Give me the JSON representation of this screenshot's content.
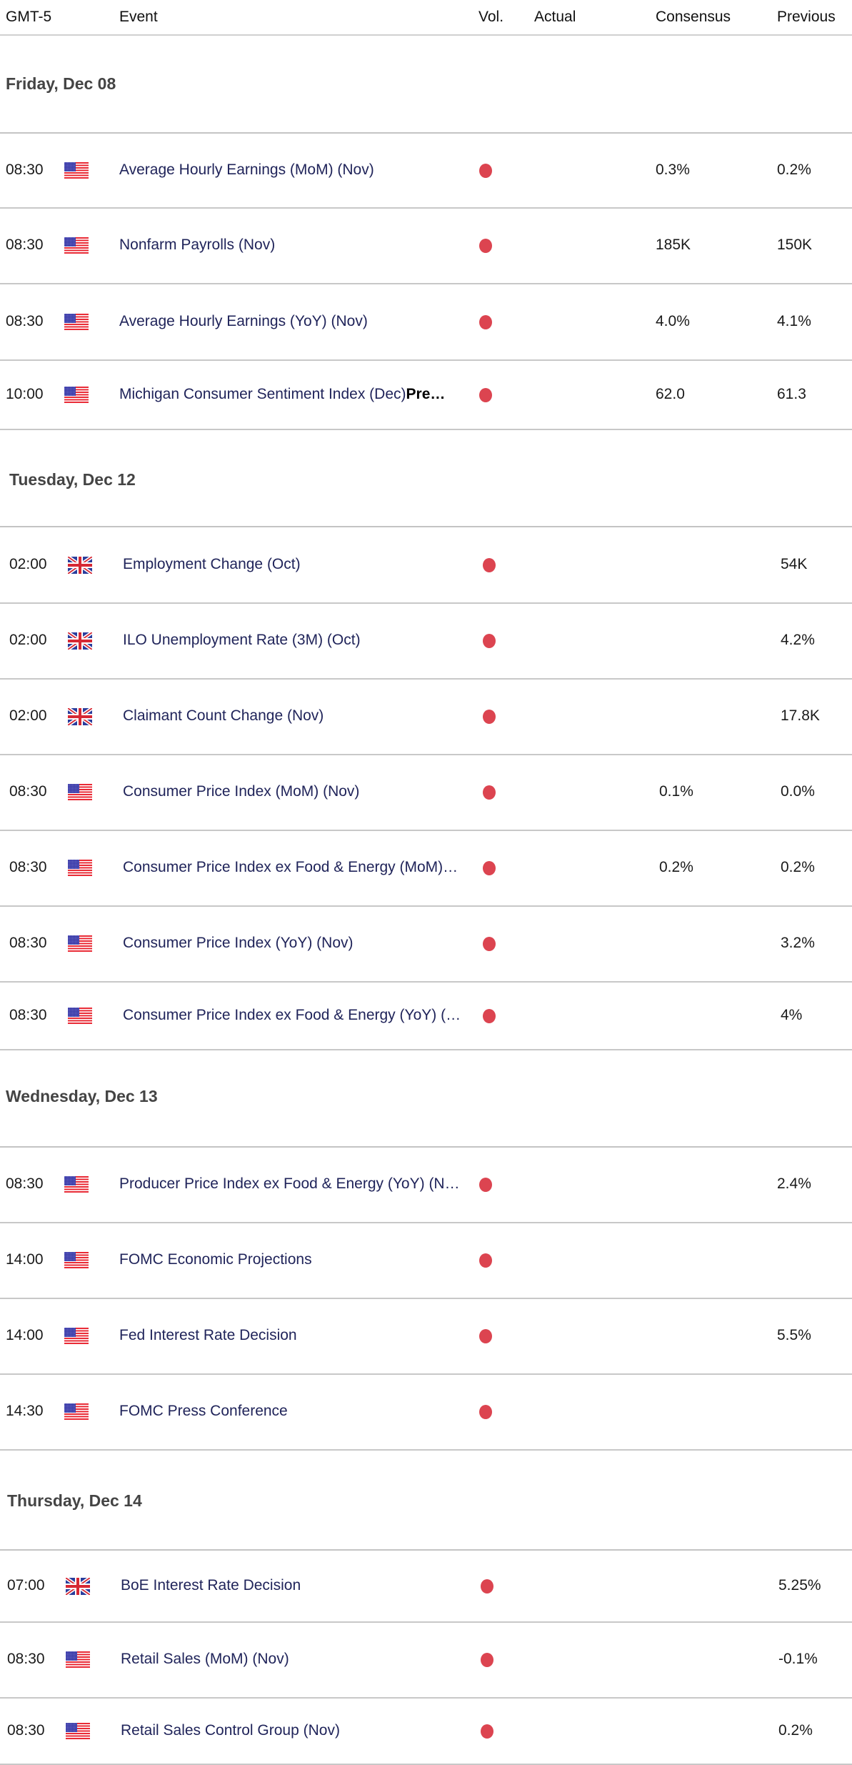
{
  "header": {
    "timezone": "GMT-5",
    "event": "Event",
    "volatility": "Vol.",
    "actual": "Actual",
    "consensus": "Consensus",
    "previous": "Previous"
  },
  "colors": {
    "volatility_high": "#dc4450",
    "event_text": "#20245a",
    "group_title": "#444444"
  },
  "groups": [
    {
      "title": "Friday, Dec 08",
      "events": [
        {
          "time": "08:30",
          "country": "US",
          "flag_icon": "us-flag-icon",
          "event": "Average Hourly Earnings (MoM) (Nov)",
          "volatility": "high",
          "actual": "",
          "consensus": "0.3%",
          "previous": "0.2%"
        },
        {
          "time": "08:30",
          "country": "US",
          "flag_icon": "us-flag-icon",
          "event": "Nonfarm Payrolls (Nov)",
          "volatility": "high",
          "actual": "",
          "consensus": "185K",
          "previous": "150K"
        },
        {
          "time": "08:30",
          "country": "US",
          "flag_icon": "us-flag-icon",
          "event": "Average Hourly Earnings (YoY) (Nov)",
          "volatility": "high",
          "actual": "",
          "consensus": "4.0%",
          "previous": "4.1%"
        },
        {
          "time": "10:00",
          "country": "US",
          "flag_icon": "us-flag-icon",
          "event": "Michigan Consumer Sentiment Index (Dec)",
          "event_suffix": "Pre…",
          "volatility": "high",
          "actual": "",
          "consensus": "62.0",
          "previous": "61.3"
        }
      ]
    },
    {
      "title": "Tuesday, Dec 12",
      "events": [
        {
          "time": "02:00",
          "country": "UK",
          "flag_icon": "uk-flag-icon",
          "event": "Employment Change (Oct)",
          "volatility": "high",
          "actual": "",
          "consensus": "",
          "previous": "54K"
        },
        {
          "time": "02:00",
          "country": "UK",
          "flag_icon": "uk-flag-icon",
          "event": "ILO Unemployment Rate (3M) (Oct)",
          "volatility": "high",
          "actual": "",
          "consensus": "",
          "previous": "4.2%"
        },
        {
          "time": "02:00",
          "country": "UK",
          "flag_icon": "uk-flag-icon",
          "event": "Claimant Count Change (Nov)",
          "volatility": "high",
          "actual": "",
          "consensus": "",
          "previous": "17.8K"
        },
        {
          "time": "08:30",
          "country": "US",
          "flag_icon": "us-flag-icon",
          "event": "Consumer Price Index (MoM) (Nov)",
          "volatility": "high",
          "actual": "",
          "consensus": "0.1%",
          "previous": "0.0%"
        },
        {
          "time": "08:30",
          "country": "US",
          "flag_icon": "us-flag-icon",
          "event": "Consumer Price Index ex Food & Energy (MoM)…",
          "volatility": "high",
          "actual": "",
          "consensus": "0.2%",
          "previous": "0.2%"
        },
        {
          "time": "08:30",
          "country": "US",
          "flag_icon": "us-flag-icon",
          "event": "Consumer Price Index (YoY) (Nov)",
          "volatility": "high",
          "actual": "",
          "consensus": "",
          "previous": "3.2%"
        },
        {
          "time": "08:30",
          "country": "US",
          "flag_icon": "us-flag-icon",
          "event": "Consumer Price Index ex Food & Energy (YoY) (…",
          "volatility": "high",
          "actual": "",
          "consensus": "",
          "previous": "4%"
        }
      ]
    },
    {
      "title": "Wednesday, Dec 13",
      "events": [
        {
          "time": "08:30",
          "country": "US",
          "flag_icon": "us-flag-icon",
          "event": "Producer Price Index ex Food & Energy (YoY) (N…",
          "volatility": "high",
          "actual": "",
          "consensus": "",
          "previous": "2.4%"
        },
        {
          "time": "14:00",
          "country": "US",
          "flag_icon": "us-flag-icon",
          "event": "FOMC Economic Projections",
          "volatility": "high",
          "actual": "",
          "consensus": "",
          "previous": ""
        },
        {
          "time": "14:00",
          "country": "US",
          "flag_icon": "us-flag-icon",
          "event": "Fed Interest Rate Decision",
          "volatility": "high",
          "actual": "",
          "consensus": "",
          "previous": "5.5%"
        },
        {
          "time": "14:30",
          "country": "US",
          "flag_icon": "us-flag-icon",
          "event": "FOMC Press Conference",
          "volatility": "high",
          "actual": "",
          "consensus": "",
          "previous": ""
        }
      ]
    },
    {
      "title": "Thursday, Dec 14",
      "events": [
        {
          "time": "07:00",
          "country": "UK",
          "flag_icon": "uk-flag-icon",
          "event": "BoE Interest Rate Decision",
          "volatility": "high",
          "actual": "",
          "consensus": "",
          "previous": "5.25%"
        },
        {
          "time": "08:30",
          "country": "US",
          "flag_icon": "us-flag-icon",
          "event": "Retail Sales (MoM) (Nov)",
          "volatility": "high",
          "actual": "",
          "consensus": "",
          "previous": "-0.1%"
        },
        {
          "time": "08:30",
          "country": "US",
          "flag_icon": "us-flag-icon",
          "event": "Retail Sales Control Group (Nov)",
          "volatility": "high",
          "actual": "",
          "consensus": "",
          "previous": "0.2%"
        }
      ]
    }
  ]
}
